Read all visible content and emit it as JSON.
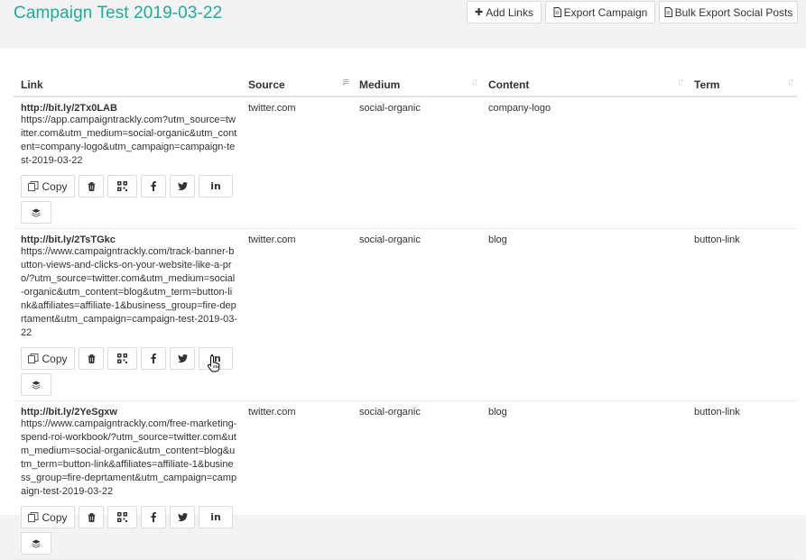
{
  "page": {
    "title": "Campaign Test 2019-03-22"
  },
  "header_buttons": {
    "add_links": "Add Links",
    "export_campaign": "Export Campaign",
    "bulk_export": "Bulk Export Social Posts"
  },
  "table": {
    "columns": {
      "link": "Link",
      "source": "Source",
      "medium": "Medium",
      "content": "Content",
      "term": "Term"
    },
    "copy_label": "Copy",
    "linkedin_label": "in",
    "rows": [
      {
        "short": "http://bit.ly/2Tx0LAB",
        "long": "https://app.campaigntrackly.com?utm_source=twitter.com&utm_medium=social-organic&utm_content=company-logo&utm_campaign=campaign-test-2019-03-22",
        "source": "twitter.com",
        "medium": "social-organic",
        "content": "company-logo",
        "term": ""
      },
      {
        "short": "http://bit.ly/2TsTGkc",
        "long": "https://www.campaigntrackly.com/track-banner-button-views-and-clicks-on-your-website-like-a-pro/?utm_source=twitter.com&utm_medium=social-organic&utm_content=blog&utm_term=button-link&affiliates=affiliate-1&business_group=fire-deprtament&utm_campaign=campaign-test-2019-03-22",
        "source": "twitter.com",
        "medium": "social-organic",
        "content": "blog",
        "term": "button-link"
      },
      {
        "short": "http://bit.ly/2YeSgxw",
        "long": "https://www.campaigntrackly.com/free-marketing-spend-roi-workbook/?utm_source=twitter.com&utm_medium=social-organic&utm_content=blog&utm_term=button-link&affiliates=affiliate-1&business_group=fire-deprtament&utm_campaign=campaign-test-2019-03-22",
        "source": "twitter.com",
        "medium": "social-organic",
        "content": "blog",
        "term": "button-link"
      }
    ]
  }
}
